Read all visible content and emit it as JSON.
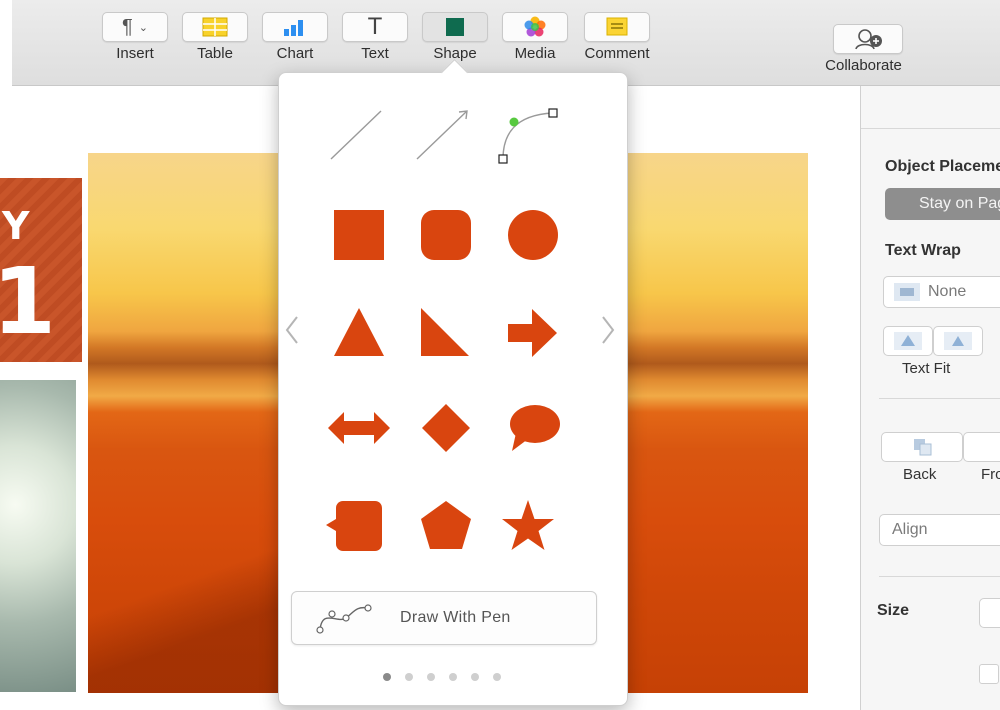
{
  "toolbar": {
    "insert_label": "Insert",
    "table_label": "Table",
    "chart_label": "Chart",
    "text_label": "Text",
    "shape_label": "Shape",
    "media_label": "Media",
    "comment_label": "Comment",
    "collaborate_label": "Collaborate"
  },
  "document": {
    "left_card_text": "Y",
    "left_card_number": "1"
  },
  "popover": {
    "draw_with_pen_label": "Draw With Pen",
    "page_count": 6,
    "current_page": 1,
    "shape_color": "#d9450f",
    "shapes": [
      "line",
      "arrow-line",
      "curve",
      "square",
      "rounded-square",
      "circle",
      "triangle",
      "right-triangle",
      "arrow",
      "double-arrow",
      "diamond",
      "speech-bubble",
      "callout-square",
      "pentagon",
      "star"
    ]
  },
  "inspector": {
    "object_placement_title": "Object Placement",
    "stay_on_page_label": "Stay on Page",
    "text_wrap_title": "Text Wrap",
    "text_wrap_value": "None",
    "text_fit_label": "Text Fit",
    "back_label": "Back",
    "front_label": "Front",
    "align_value": "Align",
    "size_title": "Size"
  },
  "colors": {
    "accent_shape": "#d9450f",
    "toolbar_bg": "#e4e4e4",
    "inspector_bg": "#f6f6f6"
  }
}
